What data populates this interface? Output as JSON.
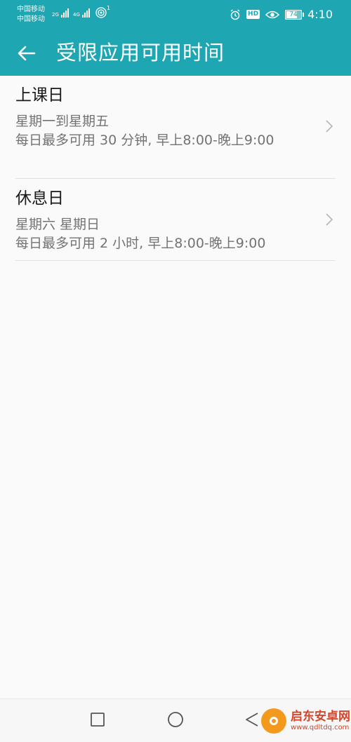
{
  "status_bar": {
    "carrier_1": "中国移动",
    "carrier_2": "中国移动",
    "network_1": "2G",
    "network_2": "4G",
    "wifi_count": "1",
    "hd_badge": "HD",
    "battery_level": "74",
    "battery_fraction": 0.74,
    "time": "4:10"
  },
  "app_bar": {
    "title": "受限应用可用时间",
    "back_icon": "arrow-left-icon"
  },
  "schedule_items": [
    {
      "title": "上课日",
      "days": "星期一到星期五",
      "detail": "每日最多可用 30 分钟, 早上8:00-晚上9:00"
    },
    {
      "title": "休息日",
      "days": "星期六 星期日",
      "detail": "每日最多可用 2 小时, 早上8:00-晚上9:00"
    }
  ],
  "navigation_bar": {
    "recent_icon": "square-icon",
    "home_icon": "circle-icon",
    "back_icon": "triangle-back-icon"
  },
  "watermark": {
    "brand": "启东安卓网",
    "url": "www.qdltdq.com"
  },
  "colors": {
    "accent": "#1ea7b3",
    "background": "#fafafa",
    "primary_text": "#1a1a1a",
    "secondary_text": "#737373"
  }
}
